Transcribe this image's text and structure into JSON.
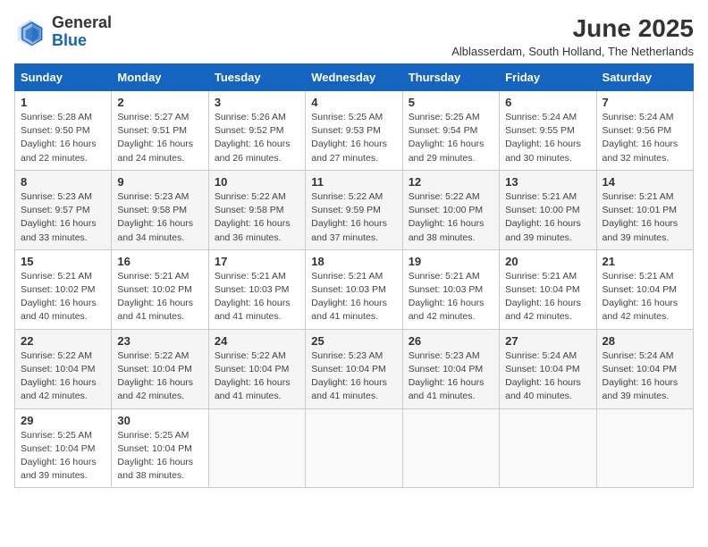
{
  "header": {
    "logo_general": "General",
    "logo_blue": "Blue",
    "month_title": "June 2025",
    "location": "Alblasserdam, South Holland, The Netherlands"
  },
  "weekdays": [
    "Sunday",
    "Monday",
    "Tuesday",
    "Wednesday",
    "Thursday",
    "Friday",
    "Saturday"
  ],
  "weeks": [
    [
      {
        "day": "1",
        "sunrise": "5:28 AM",
        "sunset": "9:50 PM",
        "daylight": "16 hours and 22 minutes."
      },
      {
        "day": "2",
        "sunrise": "5:27 AM",
        "sunset": "9:51 PM",
        "daylight": "16 hours and 24 minutes."
      },
      {
        "day": "3",
        "sunrise": "5:26 AM",
        "sunset": "9:52 PM",
        "daylight": "16 hours and 26 minutes."
      },
      {
        "day": "4",
        "sunrise": "5:25 AM",
        "sunset": "9:53 PM",
        "daylight": "16 hours and 27 minutes."
      },
      {
        "day": "5",
        "sunrise": "5:25 AM",
        "sunset": "9:54 PM",
        "daylight": "16 hours and 29 minutes."
      },
      {
        "day": "6",
        "sunrise": "5:24 AM",
        "sunset": "9:55 PM",
        "daylight": "16 hours and 30 minutes."
      },
      {
        "day": "7",
        "sunrise": "5:24 AM",
        "sunset": "9:56 PM",
        "daylight": "16 hours and 32 minutes."
      }
    ],
    [
      {
        "day": "8",
        "sunrise": "5:23 AM",
        "sunset": "9:57 PM",
        "daylight": "16 hours and 33 minutes."
      },
      {
        "day": "9",
        "sunrise": "5:23 AM",
        "sunset": "9:58 PM",
        "daylight": "16 hours and 34 minutes."
      },
      {
        "day": "10",
        "sunrise": "5:22 AM",
        "sunset": "9:58 PM",
        "daylight": "16 hours and 36 minutes."
      },
      {
        "day": "11",
        "sunrise": "5:22 AM",
        "sunset": "9:59 PM",
        "daylight": "16 hours and 37 minutes."
      },
      {
        "day": "12",
        "sunrise": "5:22 AM",
        "sunset": "10:00 PM",
        "daylight": "16 hours and 38 minutes."
      },
      {
        "day": "13",
        "sunrise": "5:21 AM",
        "sunset": "10:00 PM",
        "daylight": "16 hours and 39 minutes."
      },
      {
        "day": "14",
        "sunrise": "5:21 AM",
        "sunset": "10:01 PM",
        "daylight": "16 hours and 39 minutes."
      }
    ],
    [
      {
        "day": "15",
        "sunrise": "5:21 AM",
        "sunset": "10:02 PM",
        "daylight": "16 hours and 40 minutes."
      },
      {
        "day": "16",
        "sunrise": "5:21 AM",
        "sunset": "10:02 PM",
        "daylight": "16 hours and 41 minutes."
      },
      {
        "day": "17",
        "sunrise": "5:21 AM",
        "sunset": "10:03 PM",
        "daylight": "16 hours and 41 minutes."
      },
      {
        "day": "18",
        "sunrise": "5:21 AM",
        "sunset": "10:03 PM",
        "daylight": "16 hours and 41 minutes."
      },
      {
        "day": "19",
        "sunrise": "5:21 AM",
        "sunset": "10:03 PM",
        "daylight": "16 hours and 42 minutes."
      },
      {
        "day": "20",
        "sunrise": "5:21 AM",
        "sunset": "10:04 PM",
        "daylight": "16 hours and 42 minutes."
      },
      {
        "day": "21",
        "sunrise": "5:21 AM",
        "sunset": "10:04 PM",
        "daylight": "16 hours and 42 minutes."
      }
    ],
    [
      {
        "day": "22",
        "sunrise": "5:22 AM",
        "sunset": "10:04 PM",
        "daylight": "16 hours and 42 minutes."
      },
      {
        "day": "23",
        "sunrise": "5:22 AM",
        "sunset": "10:04 PM",
        "daylight": "16 hours and 42 minutes."
      },
      {
        "day": "24",
        "sunrise": "5:22 AM",
        "sunset": "10:04 PM",
        "daylight": "16 hours and 41 minutes."
      },
      {
        "day": "25",
        "sunrise": "5:23 AM",
        "sunset": "10:04 PM",
        "daylight": "16 hours and 41 minutes."
      },
      {
        "day": "26",
        "sunrise": "5:23 AM",
        "sunset": "10:04 PM",
        "daylight": "16 hours and 41 minutes."
      },
      {
        "day": "27",
        "sunrise": "5:24 AM",
        "sunset": "10:04 PM",
        "daylight": "16 hours and 40 minutes."
      },
      {
        "day": "28",
        "sunrise": "5:24 AM",
        "sunset": "10:04 PM",
        "daylight": "16 hours and 39 minutes."
      }
    ],
    [
      {
        "day": "29",
        "sunrise": "5:25 AM",
        "sunset": "10:04 PM",
        "daylight": "16 hours and 39 minutes."
      },
      {
        "day": "30",
        "sunrise": "5:25 AM",
        "sunset": "10:04 PM",
        "daylight": "16 hours and 38 minutes."
      },
      null,
      null,
      null,
      null,
      null
    ]
  ]
}
